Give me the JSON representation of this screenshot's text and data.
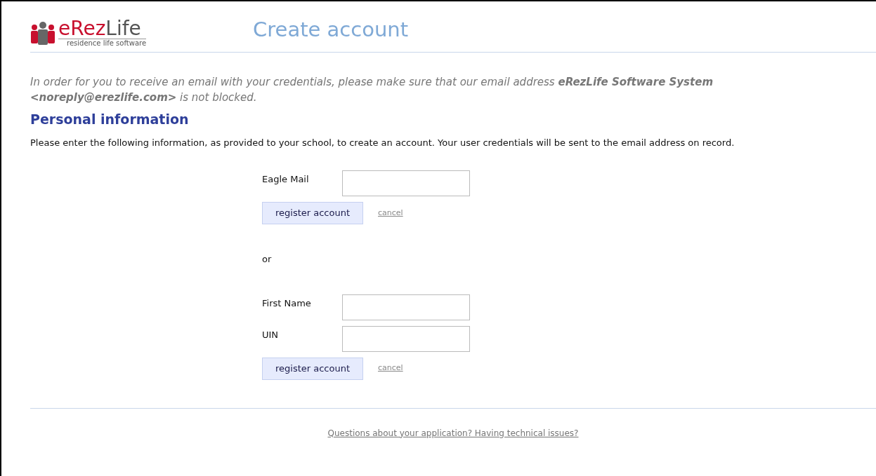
{
  "logo": {
    "name_parts": [
      "eRez",
      "Life"
    ],
    "tagline": "residence life software"
  },
  "title": "Create account",
  "notice": "In order for you to receive an email with your credentials, please make sure that our email address **eRezLife Software System <noreply@erezlife.com>** is not blocked.",
  "section_heading": "Personal information",
  "instructions": "Please enter the following information, as provided to your school, to create an account. Your user credentials will be sent to the email address on record.",
  "forms": [
    {
      "fields": [
        {
          "label": "Eagle Mail"
        }
      ],
      "button": "register account",
      "cancel": "cancel"
    },
    {
      "fields": [
        {
          "label": "First Name"
        },
        {
          "label": "UIN"
        }
      ],
      "button": "register account",
      "cancel": "cancel"
    }
  ],
  "separator": "or",
  "footer_link": "Questions about your application? Having technical issues?"
}
